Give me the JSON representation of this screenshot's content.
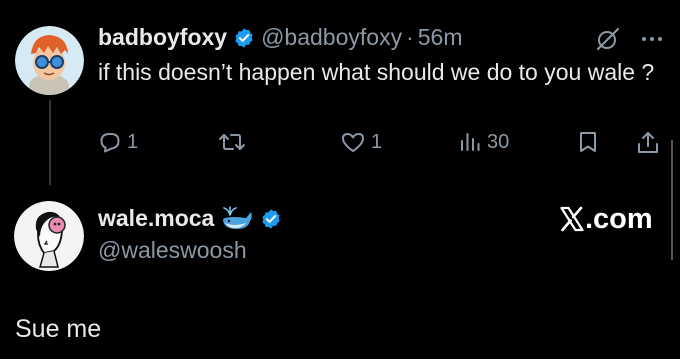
{
  "tweet1": {
    "display_name": "badboyfoxy",
    "handle": "@badboyfoxy",
    "separator": "·",
    "time": "56m",
    "text": "if this doesn’t happen what should we do to you wale ?",
    "replies": "1",
    "retweets": "",
    "likes": "1",
    "views": "30",
    "icons": [
      "verified-badge",
      "grok-icon",
      "more-icon",
      "reply-icon",
      "retweet-icon",
      "like-icon",
      "views-icon",
      "bookmark-icon",
      "share-icon"
    ]
  },
  "tweet2": {
    "display_name": "wale.moca",
    "handle": "@waleswoosh",
    "text": "Sue me",
    "icons": [
      "whale-emoji",
      "verified-badge"
    ]
  },
  "watermark": {
    "site": ".com"
  },
  "colors": {
    "background": "#000000",
    "text": "#e7e9ea",
    "muted": "#8b98a5",
    "verified": "#1d9bf0"
  }
}
